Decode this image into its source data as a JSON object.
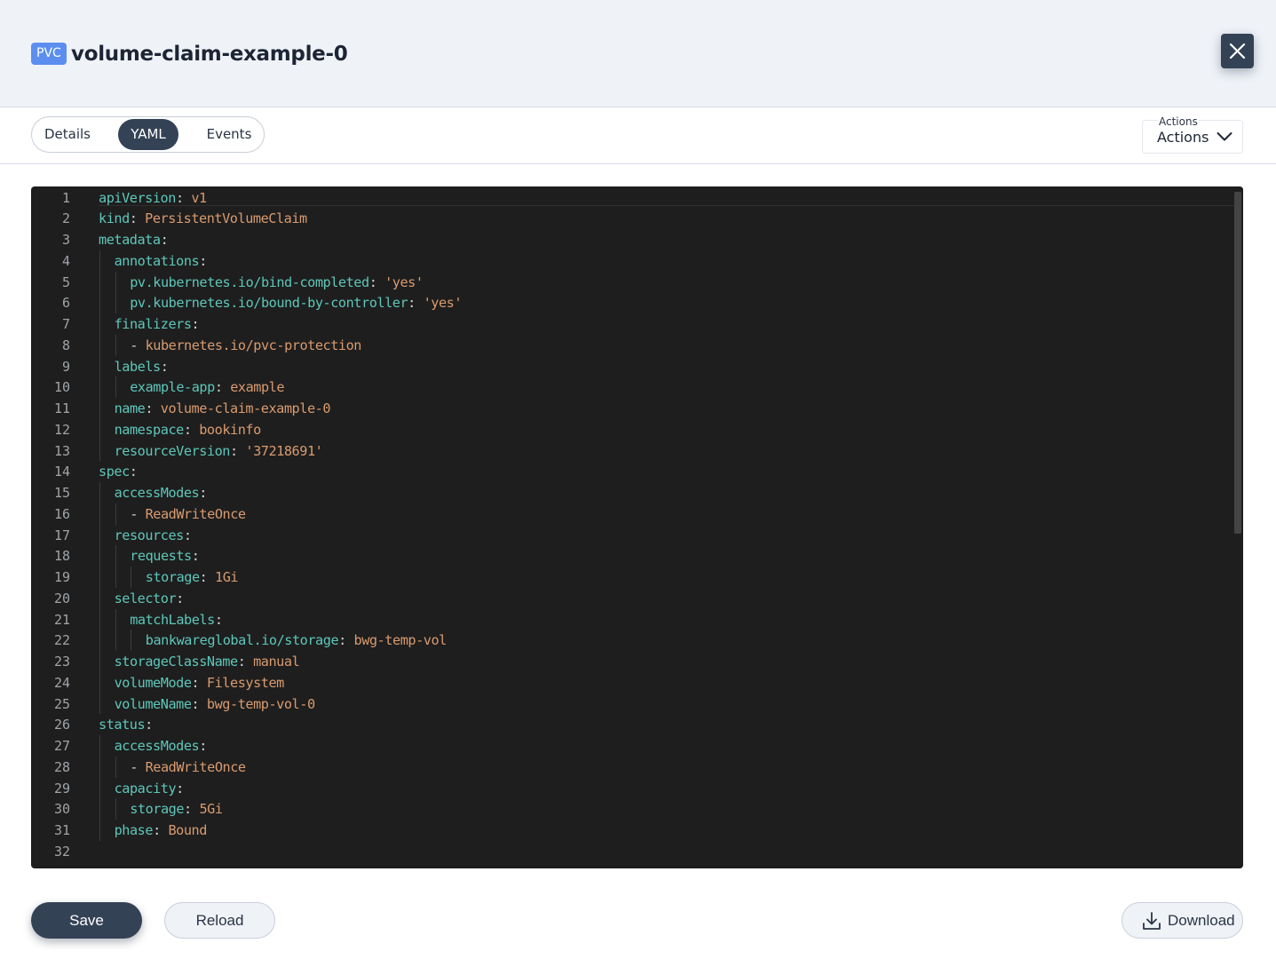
{
  "header": {
    "kind_badge": "PVC",
    "title": "volume-claim-example-0",
    "close_icon": "close-icon"
  },
  "tabs": [
    {
      "label": "Details",
      "active": false
    },
    {
      "label": "YAML",
      "active": true
    },
    {
      "label": "Events",
      "active": false
    }
  ],
  "actions": {
    "caption": "Actions",
    "label": "Actions",
    "icon": "chevron-down-icon"
  },
  "editor": {
    "line_numbers": [
      "1",
      "2",
      "3",
      "4",
      "5",
      "6",
      "7",
      "8",
      "9",
      "10",
      "11",
      "12",
      "13",
      "14",
      "15",
      "16",
      "17",
      "18",
      "19",
      "20",
      "21",
      "22",
      "23",
      "24",
      "25",
      "26",
      "27",
      "28",
      "29",
      "30",
      "31",
      "32"
    ],
    "lines": [
      {
        "indent": 0,
        "key": "apiVersion",
        "value": "v1"
      },
      {
        "indent": 0,
        "key": "kind",
        "value": "PersistentVolumeClaim"
      },
      {
        "indent": 0,
        "key": "metadata",
        "value": ""
      },
      {
        "indent": 1,
        "key": "annotations",
        "value": ""
      },
      {
        "indent": 2,
        "key": "pv.kubernetes.io/bind-completed",
        "value": "'yes'"
      },
      {
        "indent": 2,
        "key": "pv.kubernetes.io/bound-by-controller",
        "value": "'yes'"
      },
      {
        "indent": 1,
        "key": "finalizers",
        "value": ""
      },
      {
        "indent": 2,
        "item": "kubernetes.io/pvc-protection"
      },
      {
        "indent": 1,
        "key": "labels",
        "value": ""
      },
      {
        "indent": 2,
        "key": "example-app",
        "value": "example"
      },
      {
        "indent": 1,
        "key": "name",
        "value": "volume-claim-example-0"
      },
      {
        "indent": 1,
        "key": "namespace",
        "value": "bookinfo"
      },
      {
        "indent": 1,
        "key": "resourceVersion",
        "value": "'37218691'"
      },
      {
        "indent": 0,
        "key": "spec",
        "value": ""
      },
      {
        "indent": 1,
        "key": "accessModes",
        "value": ""
      },
      {
        "indent": 2,
        "item": "ReadWriteOnce"
      },
      {
        "indent": 1,
        "key": "resources",
        "value": ""
      },
      {
        "indent": 2,
        "key": "requests",
        "value": ""
      },
      {
        "indent": 3,
        "key": "storage",
        "value": "1Gi"
      },
      {
        "indent": 1,
        "key": "selector",
        "value": ""
      },
      {
        "indent": 2,
        "key": "matchLabels",
        "value": ""
      },
      {
        "indent": 3,
        "key": "bankwareglobal.io/storage",
        "value": "bwg-temp-vol"
      },
      {
        "indent": 1,
        "key": "storageClassName",
        "value": "manual"
      },
      {
        "indent": 1,
        "key": "volumeMode",
        "value": "Filesystem"
      },
      {
        "indent": 1,
        "key": "volumeName",
        "value": "bwg-temp-vol-0"
      },
      {
        "indent": 0,
        "key": "status",
        "value": ""
      },
      {
        "indent": 1,
        "key": "accessModes",
        "value": ""
      },
      {
        "indent": 2,
        "item": "ReadWriteOnce"
      },
      {
        "indent": 1,
        "key": "capacity",
        "value": ""
      },
      {
        "indent": 2,
        "key": "storage",
        "value": "5Gi"
      },
      {
        "indent": 1,
        "key": "phase",
        "value": "Bound"
      },
      {
        "indent": 0,
        "key": "",
        "value": ""
      }
    ]
  },
  "footer": {
    "save_label": "Save",
    "reload_label": "Reload",
    "download_label": "Download",
    "download_icon": "download-icon"
  },
  "colors": {
    "primary": "#344256",
    "badge": "#5c8ef0",
    "yaml_key": "#5ec7ba",
    "yaml_value": "#d99b6f",
    "editor_bg": "#1e1e1e"
  }
}
